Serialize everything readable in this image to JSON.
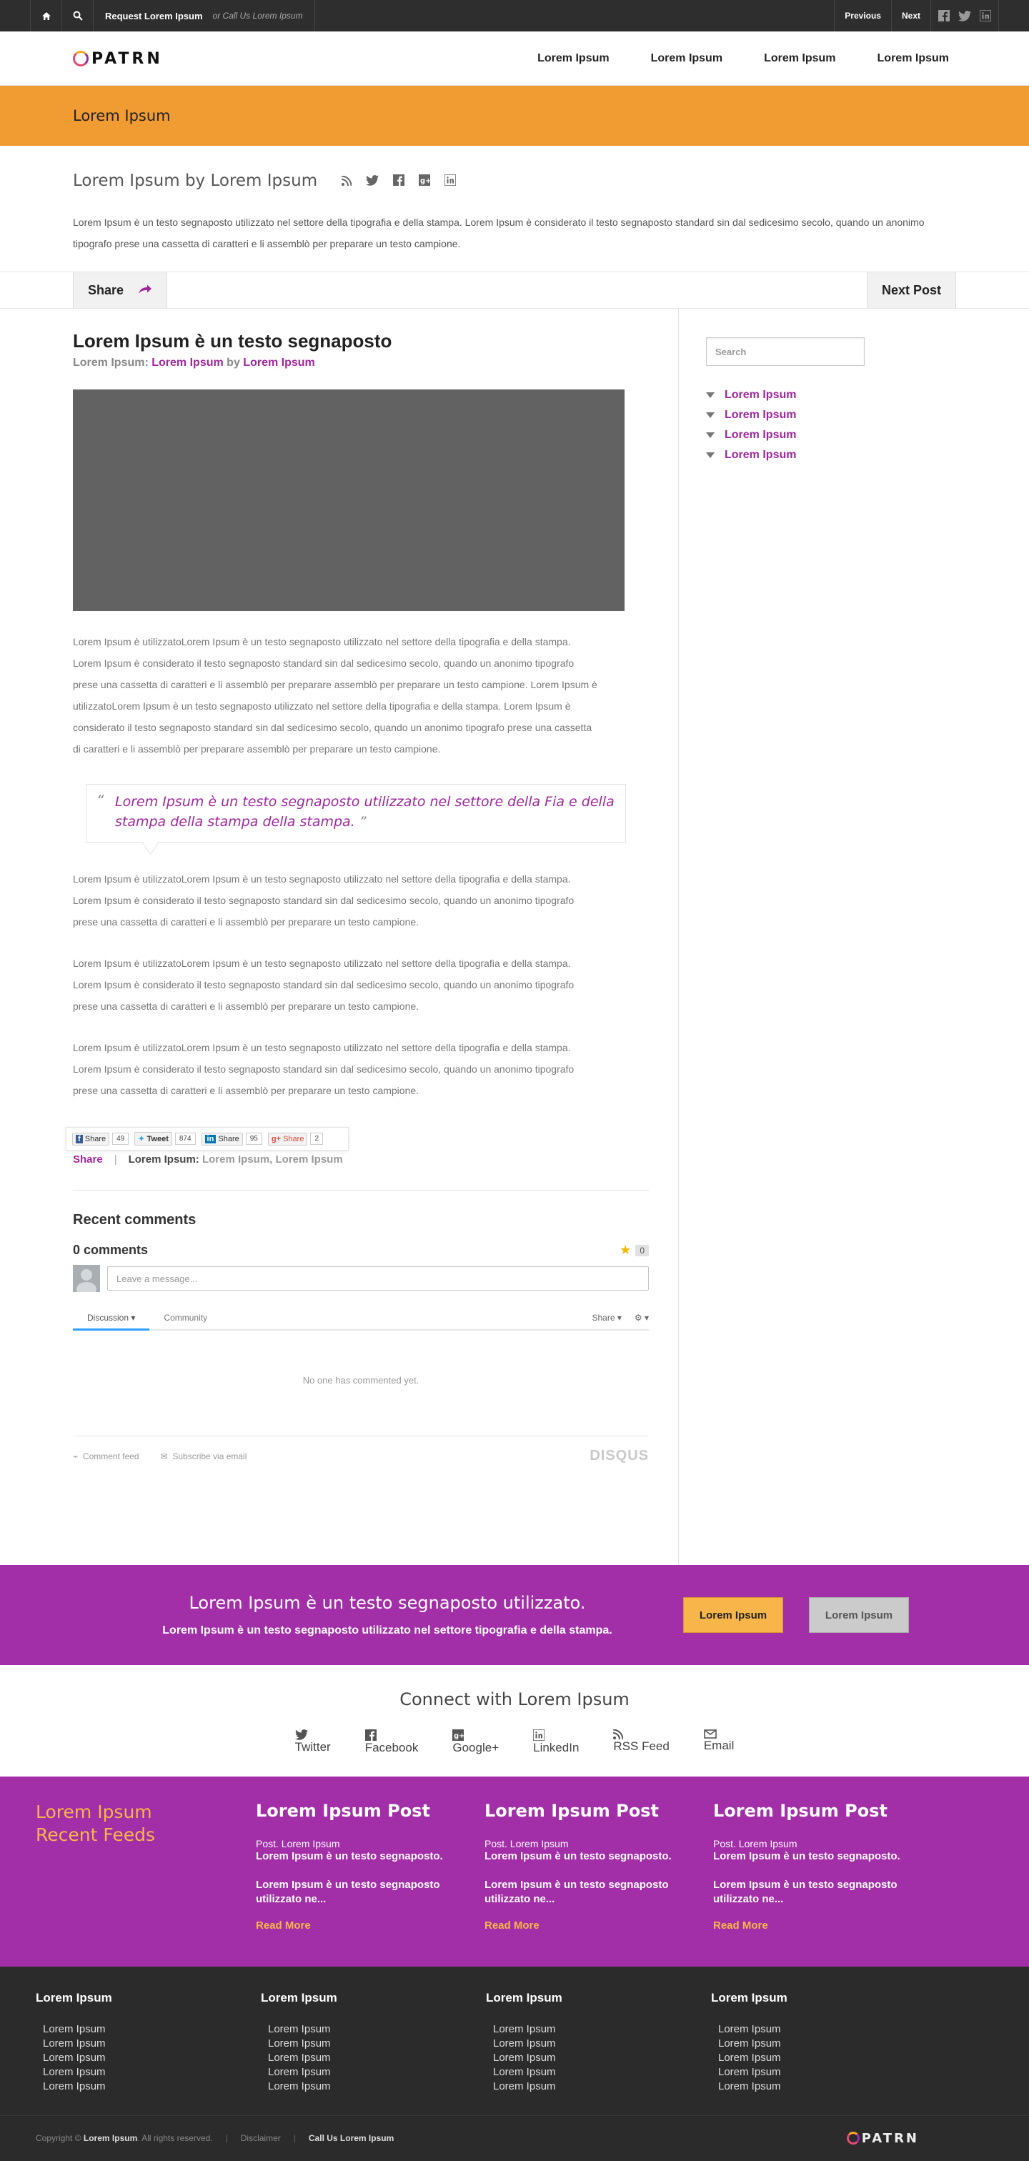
{
  "topbar": {
    "request_label": "Request Lorem Ipsum",
    "or_label": "or Call Us Lorem Ipsum",
    "previous_label": "Previous",
    "next_label": "Next"
  },
  "header": {
    "logo_text": "PATRN",
    "nav": [
      "Lorem Ipsum",
      "Lorem Ipsum",
      "Lorem Ipsum",
      "Lorem Ipsum"
    ]
  },
  "page_title": "Lorem Ipsum",
  "intro": {
    "title": "Lorem Ipsum by Lorem Ipsum",
    "text": "Lorem Ipsum è un testo segnaposto utilizzato nel settore della tipografia e della stampa. Lorem Ipsum è considerato il testo segnaposto standard sin dal sedicesimo secolo, quando un anonimo tipografo prese una cassetta di caratteri e li assemblò per preparare un testo campione."
  },
  "sharebar": {
    "share_label": "Share",
    "next_post_label": "Next Post"
  },
  "post": {
    "title": "Lorem Ipsum è un testo segnaposto",
    "meta_prefix": "Lorem Ipsum:",
    "meta_category": "Lorem Ipsum",
    "meta_by": "by",
    "meta_author": "Lorem Ipsum",
    "paragraph": "Lorem Ipsum è utilizzatoLorem Ipsum è un testo segnaposto utilizzato nel settore della tipografia e della stampa. Lorem Ipsum è considerato il testo segnaposto standard sin dal sedicesimo secolo, quando un anonimo tipografo prese una cassetta di caratteri e li assemblò per preparare assemblò per preparare un testo campione. Lorem Ipsum è utilizzatoLorem Ipsum è un testo segnaposto utilizzato nel settore della tipografia e della stampa. Lorem Ipsum è considerato il testo segnaposto standard sin dal sedicesimo secolo, quando un anonimo tipografo prese una cassetta di caratteri e li assemblò per preparare assemblò per preparare un testo campione.",
    "quote": "Lorem Ipsum è un testo segnaposto utilizzato nel settore della Fia e della stampa della stampa della stampa.",
    "paragraphs": [
      "Lorem Ipsum è utilizzatoLorem Ipsum è un testo segnaposto utilizzato nel settore della tipografia e della stampa. Lorem Ipsum è considerato il testo segnaposto standard sin dal sedicesimo secolo, quando un anonimo tipografo prese una cassetta di caratteri e li assemblò per preparare un testo campione.",
      "Lorem Ipsum è utilizzatoLorem Ipsum è un testo segnaposto utilizzato nel settore della tipografia e della stampa. Lorem Ipsum è considerato il testo segnaposto standard sin dal sedicesimo secolo, quando un anonimo tipografo prese una cassetta di caratteri e li assemblò per preparare un testo campione.",
      "Lorem Ipsum è utilizzatoLorem Ipsum è un testo segnaposto utilizzato nel settore della tipografia e della stampa. Lorem Ipsum è considerato il testo segnaposto standard sin dal sedicesimo secolo, quando un anonimo tipografo prese una cassetta di caratteri e li assemblò per preparare un testo campione."
    ],
    "share_buttons": [
      {
        "label": "Share",
        "count": "49"
      },
      {
        "label": "Tweet",
        "count": "874"
      },
      {
        "label": "Share",
        "count": "95"
      },
      {
        "label": "Share",
        "count": "2"
      }
    ],
    "foot_share": "Share",
    "foot_sep": "|",
    "foot_prefix": "Lorem Ipsum:",
    "foot_tags": "Lorem Ipsum, Lorem Ipsum"
  },
  "comments": {
    "title": "Recent comments",
    "count_label": "0 comments",
    "star_count": "0",
    "input_placeholder": "Leave a message...",
    "tab_discussion": "Discussion",
    "tab_community": "Community",
    "share_label": "Share",
    "empty": "No one has commented yet.",
    "feed_label": "Comment feed",
    "subscribe_label": "Subscribe via email",
    "brand": "DISQUS"
  },
  "sidebar": {
    "search_placeholder": "Search",
    "categories": [
      "Lorem Ipsum",
      "Lorem Ipsum",
      "Lorem Ipsum",
      "Lorem Ipsum"
    ]
  },
  "cta": {
    "heading": "Lorem Ipsum è un testo segnaposto utilizzato.",
    "text": "Lorem Ipsum è un testo segnaposto utilizzato nel settore tipografia e della stampa.",
    "button_primary": "Lorem Ipsum",
    "button_secondary": "Lorem Ipsum"
  },
  "connect": {
    "title": "Connect with Lorem Ipsum",
    "links": [
      "Twitter",
      "Facebook",
      "Google+",
      "LinkedIn",
      "RSS Feed",
      "Email"
    ]
  },
  "feeds": {
    "left_line1": "Lorem Ipsum",
    "left_line2": "Recent Feeds",
    "columns": [
      {
        "title": "Lorem Ipsum Post",
        "meta_prefix": "Post.",
        "meta_name": "Lorem Ipsum",
        "line1": "Lorem Ipsum è un testo segnaposto.",
        "line2": "Lorem Ipsum è un testo segnaposto utilizzato ne...",
        "read_more": "Read More"
      },
      {
        "title": "Lorem Ipsum Post",
        "meta_prefix": "Post.",
        "meta_name": "Lorem Ipsum",
        "line1": "Lorem Ipsum è un testo segnaposto.",
        "line2": "Lorem Ipsum è un testo segnaposto utilizzato ne...",
        "read_more": "Read More"
      },
      {
        "title": "Lorem Ipsum Post",
        "meta_prefix": "Post.",
        "meta_name": "Lorem Ipsum",
        "line1": "Lorem Ipsum è un testo segnaposto.",
        "line2": "Lorem Ipsum è un testo segnaposto utilizzato ne...",
        "read_more": "Read More"
      }
    ]
  },
  "footer": {
    "columns": [
      {
        "title": "Lorem Ipsum",
        "items": [
          "Lorem Ipsum",
          "Lorem Ipsum",
          "Lorem Ipsum",
          "Lorem Ipsum",
          "Lorem Ipsum"
        ]
      },
      {
        "title": "Lorem Ipsum",
        "items": [
          "Lorem Ipsum",
          "Lorem Ipsum",
          "Lorem Ipsum",
          "Lorem Ipsum",
          "Lorem Ipsum"
        ]
      },
      {
        "title": "Lorem Ipsum",
        "items": [
          "Lorem Ipsum",
          "Lorem Ipsum",
          "Lorem Ipsum",
          "Lorem Ipsum",
          "Lorem Ipsum"
        ]
      },
      {
        "title": "Lorem Ipsum",
        "items": [
          "Lorem Ipsum",
          "Lorem Ipsum",
          "Lorem Ipsum",
          "Lorem Ipsum",
          "Lorem Ipsum"
        ]
      }
    ],
    "copyright_prefix": "Copyright ©",
    "copyright_name": "Lorem Ipsum",
    "copyright_suffix": ". All rights reserved.",
    "sep": "|",
    "disclaimer": "Disclaimer",
    "call_us": "Call Us Lorem Ipsum",
    "logo_text": "PATRN"
  },
  "colors": {
    "accent_orange": "#f19c33",
    "accent_purple": "#a22ea8",
    "link_purple": "#a0279f",
    "topbar": "#2e2e2e",
    "footer": "#2b2b2b"
  },
  "icons": [
    "home-icon",
    "search-icon",
    "facebook-icon",
    "twitter-icon",
    "linkedin-icon",
    "rss-icon",
    "google-plus-icon",
    "share-arrow-icon",
    "star-icon",
    "gear-icon",
    "email-icon"
  ]
}
